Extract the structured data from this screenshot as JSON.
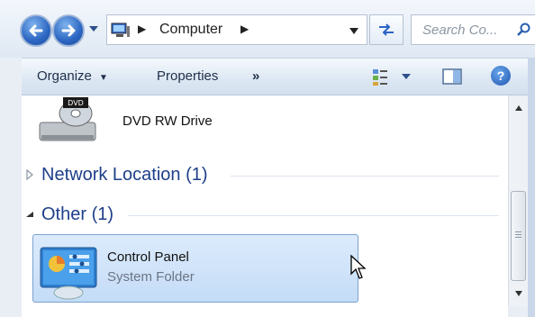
{
  "address_bar": {
    "breadcrumb": "Computer",
    "search_placeholder": "Search Co...",
    "back_icon": "back-arrow-icon",
    "forward_icon": "forward-arrow-icon"
  },
  "command_bar": {
    "organize_label": "Organize",
    "properties_label": "Properties",
    "more_label": "»",
    "help_label": "?"
  },
  "content": {
    "dvd_label": "DVD RW Drive",
    "groups": [
      {
        "title": "Network Location (1)",
        "expanded": false
      },
      {
        "title": "Other (1)",
        "expanded": true
      }
    ],
    "items": [
      {
        "name": "Control Panel",
        "type": "System Folder",
        "selected": true
      }
    ]
  },
  "colors": {
    "accent": "#1e3f8a",
    "selection": "#c4dcf7",
    "nav_button": "#2c66c2"
  }
}
